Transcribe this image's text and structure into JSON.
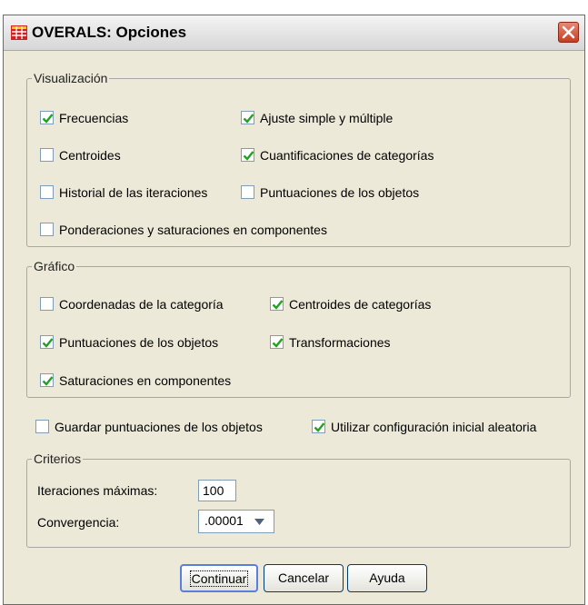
{
  "window": {
    "title": "OVERALS: Opciones"
  },
  "icons": {
    "app": "grid-table-icon",
    "close": "close-icon",
    "check": "checkmark-icon",
    "dropdown": "chevron-down-icon"
  },
  "colors": {
    "check": "#21a121",
    "close": "#c63d22",
    "default_border": "#5a7edc"
  },
  "display": {
    "legend": "Visualización",
    "options": [
      {
        "label": "Frecuencias",
        "checked": true
      },
      {
        "label": "Ajuste simple y múltiple",
        "checked": true
      },
      {
        "label": "Centroides",
        "checked": false
      },
      {
        "label": "Cuantificaciones de categorías",
        "checked": true
      },
      {
        "label": "Historial de las iteraciones",
        "checked": false
      },
      {
        "label": "Puntuaciones de los objetos",
        "checked": false
      },
      {
        "label": "Ponderaciones y saturaciones en componentes",
        "checked": false
      }
    ]
  },
  "plot": {
    "legend": "Gráfico",
    "options": [
      {
        "label": "Coordenadas de la categoría",
        "checked": false
      },
      {
        "label": "Centroides de categorías",
        "checked": true
      },
      {
        "label": "Puntuaciones de los objetos",
        "checked": true
      },
      {
        "label": "Transformaciones",
        "checked": true
      },
      {
        "label": "Saturaciones en componentes",
        "checked": true
      }
    ]
  },
  "extra": {
    "options": [
      {
        "label": "Guardar puntuaciones de los objetos",
        "checked": false
      },
      {
        "label": "Utilizar configuración inicial aleatoria",
        "checked": true
      }
    ]
  },
  "criteria": {
    "legend": "Criterios",
    "max_iterations_label": "Iteraciones máximas:",
    "max_iterations_value": "100",
    "convergence_label": "Convergencia:",
    "convergence_value": ".00001"
  },
  "buttons": {
    "continue": "Continuar",
    "cancel": "Cancelar",
    "help": "Ayuda"
  }
}
